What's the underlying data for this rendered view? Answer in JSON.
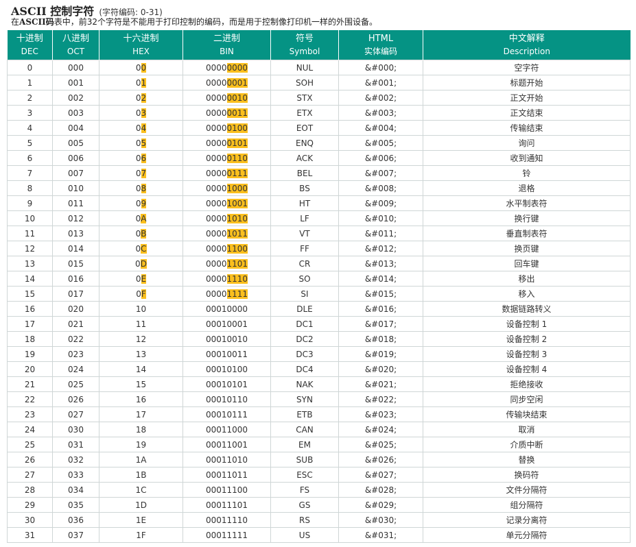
{
  "page": {
    "title": "ASCII 控制字符",
    "subtitle": "(字符编码: 0-31)",
    "description": {
      "prefix": "在",
      "bold": "ASCII码",
      "suffix": "表中，前32个字符是不能用于打印控制的编码，而是用于控制像打印机一样的外围设备。"
    }
  },
  "colors": {
    "header_bg": "#059384",
    "highlight": "#fbbf1d",
    "border": "#cfd6d6"
  },
  "table": {
    "headers": [
      {
        "cn": "十进制",
        "en": "DEC"
      },
      {
        "cn": "八进制",
        "en": "OCT"
      },
      {
        "cn": "十六进制",
        "en": "HEX"
      },
      {
        "cn": "二进制",
        "en": "BIN"
      },
      {
        "cn": "符号",
        "en": "Symbol"
      },
      {
        "cn": "HTML",
        "en": "实体编码"
      },
      {
        "cn": "中文解释",
        "en": "Description"
      }
    ],
    "rows": [
      {
        "dec": "0",
        "oct": "000",
        "hex": "00",
        "bin": "00000000",
        "symbol": "NUL",
        "html": "&#000;",
        "desc": "空字符"
      },
      {
        "dec": "1",
        "oct": "001",
        "hex": "01",
        "bin": "00000001",
        "symbol": "SOH",
        "html": "&#001;",
        "desc": "标题开始"
      },
      {
        "dec": "2",
        "oct": "002",
        "hex": "02",
        "bin": "00000010",
        "symbol": "STX",
        "html": "&#002;",
        "desc": "正文开始"
      },
      {
        "dec": "3",
        "oct": "003",
        "hex": "03",
        "bin": "00000011",
        "symbol": "ETX",
        "html": "&#003;",
        "desc": "正文结束"
      },
      {
        "dec": "4",
        "oct": "004",
        "hex": "04",
        "bin": "00000100",
        "symbol": "EOT",
        "html": "&#004;",
        "desc": "传输结束"
      },
      {
        "dec": "5",
        "oct": "005",
        "hex": "05",
        "bin": "00000101",
        "symbol": "ENQ",
        "html": "&#005;",
        "desc": "询问"
      },
      {
        "dec": "6",
        "oct": "006",
        "hex": "06",
        "bin": "00000110",
        "symbol": "ACK",
        "html": "&#006;",
        "desc": "收到通知"
      },
      {
        "dec": "7",
        "oct": "007",
        "hex": "07",
        "bin": "00000111",
        "symbol": "BEL",
        "html": "&#007;",
        "desc": "铃"
      },
      {
        "dec": "8",
        "oct": "010",
        "hex": "08",
        "bin": "00001000",
        "symbol": "BS",
        "html": "&#008;",
        "desc": "退格"
      },
      {
        "dec": "9",
        "oct": "011",
        "hex": "09",
        "bin": "00001001",
        "symbol": "HT",
        "html": "&#009;",
        "desc": "水平制表符"
      },
      {
        "dec": "10",
        "oct": "012",
        "hex": "0A",
        "bin": "00001010",
        "symbol": "LF",
        "html": "&#010;",
        "desc": "换行键"
      },
      {
        "dec": "11",
        "oct": "013",
        "hex": "0B",
        "bin": "00001011",
        "symbol": "VT",
        "html": "&#011;",
        "desc": "垂直制表符"
      },
      {
        "dec": "12",
        "oct": "014",
        "hex": "0C",
        "bin": "00001100",
        "symbol": "FF",
        "html": "&#012;",
        "desc": "换页键"
      },
      {
        "dec": "13",
        "oct": "015",
        "hex": "0D",
        "bin": "00001101",
        "symbol": "CR",
        "html": "&#013;",
        "desc": "回车键"
      },
      {
        "dec": "14",
        "oct": "016",
        "hex": "0E",
        "bin": "00001110",
        "symbol": "SO",
        "html": "&#014;",
        "desc": "移出"
      },
      {
        "dec": "15",
        "oct": "017",
        "hex": "0F",
        "bin": "00001111",
        "symbol": "SI",
        "html": "&#015;",
        "desc": "移入"
      },
      {
        "dec": "16",
        "oct": "020",
        "hex": "10",
        "bin": "00010000",
        "symbol": "DLE",
        "html": "&#016;",
        "desc": "数据链路转义"
      },
      {
        "dec": "17",
        "oct": "021",
        "hex": "11",
        "bin": "00010001",
        "symbol": "DC1",
        "html": "&#017;",
        "desc": "设备控制 1"
      },
      {
        "dec": "18",
        "oct": "022",
        "hex": "12",
        "bin": "00010010",
        "symbol": "DC2",
        "html": "&#018;",
        "desc": "设备控制 2"
      },
      {
        "dec": "19",
        "oct": "023",
        "hex": "13",
        "bin": "00010011",
        "symbol": "DC3",
        "html": "&#019;",
        "desc": "设备控制 3"
      },
      {
        "dec": "20",
        "oct": "024",
        "hex": "14",
        "bin": "00010100",
        "symbol": "DC4",
        "html": "&#020;",
        "desc": "设备控制 4"
      },
      {
        "dec": "21",
        "oct": "025",
        "hex": "15",
        "bin": "00010101",
        "symbol": "NAK",
        "html": "&#021;",
        "desc": "拒绝接收"
      },
      {
        "dec": "22",
        "oct": "026",
        "hex": "16",
        "bin": "00010110",
        "symbol": "SYN",
        "html": "&#022;",
        "desc": "同步空闲"
      },
      {
        "dec": "23",
        "oct": "027",
        "hex": "17",
        "bin": "00010111",
        "symbol": "ETB",
        "html": "&#023;",
        "desc": "传输块结束"
      },
      {
        "dec": "24",
        "oct": "030",
        "hex": "18",
        "bin": "00011000",
        "symbol": "CAN",
        "html": "&#024;",
        "desc": "取消"
      },
      {
        "dec": "25",
        "oct": "031",
        "hex": "19",
        "bin": "00011001",
        "symbol": "EM",
        "html": "&#025;",
        "desc": "介质中断"
      },
      {
        "dec": "26",
        "oct": "032",
        "hex": "1A",
        "bin": "00011010",
        "symbol": "SUB",
        "html": "&#026;",
        "desc": "替换"
      },
      {
        "dec": "27",
        "oct": "033",
        "hex": "1B",
        "bin": "00011011",
        "symbol": "ESC",
        "html": "&#027;",
        "desc": "换码符"
      },
      {
        "dec": "28",
        "oct": "034",
        "hex": "1C",
        "bin": "00011100",
        "symbol": "FS",
        "html": "&#028;",
        "desc": "文件分隔符"
      },
      {
        "dec": "29",
        "oct": "035",
        "hex": "1D",
        "bin": "00011101",
        "symbol": "GS",
        "html": "&#029;",
        "desc": "组分隔符"
      },
      {
        "dec": "30",
        "oct": "036",
        "hex": "1E",
        "bin": "00011110",
        "symbol": "RS",
        "html": "&#030;",
        "desc": "记录分离符"
      },
      {
        "dec": "31",
        "oct": "037",
        "hex": "1F",
        "bin": "00011111",
        "symbol": "US",
        "html": "&#031;",
        "desc": "单元分隔符"
      }
    ]
  }
}
